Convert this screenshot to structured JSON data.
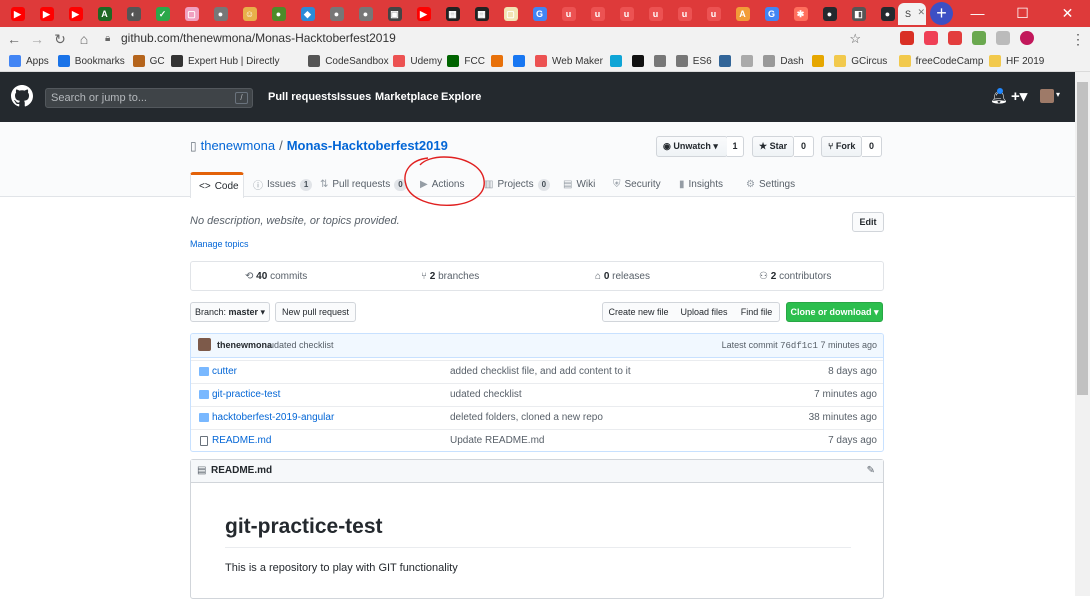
{
  "browser": {
    "url": "github.com/thenewmona/Monas-Hacktoberfest2019",
    "active_tab_label": "S",
    "tabs": [
      {
        "icon": "youtube-icon",
        "color": "#ff0000",
        "glyph": "▶"
      },
      {
        "icon": "youtube-icon",
        "color": "#ff0000",
        "glyph": "▶"
      },
      {
        "icon": "youtube-icon",
        "color": "#ff0000",
        "glyph": "▶"
      },
      {
        "icon": "code-icon",
        "color": "#1e6823",
        "glyph": "A"
      },
      {
        "icon": "git-icon",
        "color": "#555555",
        "glyph": "◐"
      },
      {
        "icon": "check-icon",
        "color": "#2ba84a",
        "glyph": "✓"
      },
      {
        "icon": "doc-icon",
        "color": "#f0a0c0",
        "glyph": "▢"
      },
      {
        "icon": "globe-icon",
        "color": "#777777",
        "glyph": "●"
      },
      {
        "icon": "smiley-icon",
        "color": "#e8b04a",
        "glyph": "☺"
      },
      {
        "icon": "leaf-icon",
        "color": "#4d8c2a",
        "glyph": "●"
      },
      {
        "icon": "shield-icon",
        "color": "#2b8ad8",
        "glyph": "◆"
      },
      {
        "icon": "globe-icon",
        "color": "#777777",
        "glyph": "●"
      },
      {
        "icon": "globe-icon",
        "color": "#777777",
        "glyph": "●"
      },
      {
        "icon": "terminal-icon",
        "color": "#444444",
        "glyph": "▣"
      },
      {
        "icon": "youtube-icon",
        "color": "#ff0000",
        "glyph": "▶"
      },
      {
        "icon": "qr-icon",
        "color": "#222222",
        "glyph": "▦"
      },
      {
        "icon": "qr-icon",
        "color": "#222222",
        "glyph": "▦"
      },
      {
        "icon": "doc-icon",
        "color": "#f2e3b3",
        "glyph": "▢"
      },
      {
        "icon": "google-icon",
        "color": "#4285f4",
        "glyph": "G"
      },
      {
        "icon": "udemy-icon",
        "color": "#ec5252",
        "glyph": "u"
      },
      {
        "icon": "udemy-icon",
        "color": "#ec5252",
        "glyph": "u"
      },
      {
        "icon": "udemy-icon",
        "color": "#ec5252",
        "glyph": "u"
      },
      {
        "icon": "udemy-icon",
        "color": "#ec5252",
        "glyph": "u"
      },
      {
        "icon": "udemy-icon",
        "color": "#ec5252",
        "glyph": "u"
      },
      {
        "icon": "udemy-icon",
        "color": "#ec5252",
        "glyph": "u"
      },
      {
        "icon": "warning-icon",
        "color": "#f29c38",
        "glyph": "A"
      },
      {
        "icon": "google-icon",
        "color": "#4285f4",
        "glyph": "G"
      },
      {
        "icon": "star-icon",
        "color": "#ff6f5e",
        "glyph": "✱"
      },
      {
        "icon": "github-icon",
        "color": "#24292e",
        "glyph": "●"
      },
      {
        "icon": "code-icon",
        "color": "#555555",
        "glyph": "◧"
      },
      {
        "icon": "github-icon",
        "color": "#24292e",
        "glyph": "●"
      }
    ],
    "extensions": [
      {
        "icon": "star-icon",
        "color": "#f2f2f2"
      },
      {
        "icon": "gmail-icon",
        "color": "#d93025"
      },
      {
        "icon": "pocket-icon",
        "color": "#ef4056"
      },
      {
        "icon": "adblock-icon",
        "color": "#e33d3d"
      },
      {
        "icon": "reader-icon",
        "color": "#6aa84f"
      },
      {
        "icon": "window-icon",
        "color": "#bbbbbb"
      },
      {
        "icon": "profile-avatar",
        "color": "#c2185b"
      }
    ],
    "bookmarks": [
      {
        "label": "Apps",
        "icon": "apps-icon",
        "color": "#4285f4"
      },
      {
        "label": "Bookmarks",
        "icon": "star-icon",
        "color": "#1a73e8"
      },
      {
        "label": "GC",
        "icon": "gc-icon",
        "color": "#b5651d"
      },
      {
        "label": "Expert Hub | Directly",
        "icon": "directly-icon",
        "color": "#333333"
      },
      {
        "label": "CodeSandbox",
        "icon": "codesandbox-icon",
        "color": "#555555"
      },
      {
        "label": "Udemy",
        "icon": "udemy-icon",
        "color": "#ec5252"
      },
      {
        "label": "FCC",
        "icon": "fcc-icon",
        "color": "#006400"
      },
      {
        "label": "",
        "icon": "circle-icon",
        "color": "#e8710a"
      },
      {
        "label": "",
        "icon": "facebook-icon",
        "color": "#1877f2"
      },
      {
        "label": "Web Maker",
        "icon": "webmaker-icon",
        "color": "#ec5252"
      },
      {
        "label": "",
        "icon": "u-icon",
        "color": "#0fa5d6"
      },
      {
        "label": "",
        "icon": "w-icon",
        "color": "#111111"
      },
      {
        "label": "",
        "icon": "gear-icon",
        "color": "#777777"
      },
      {
        "label": "ES6",
        "icon": "es6-icon",
        "color": "#777777"
      },
      {
        "label": "",
        "icon": "code-icon",
        "color": "#336699"
      },
      {
        "label": "",
        "icon": "dot-icon",
        "color": "#aaaaaa"
      },
      {
        "label": "Dash",
        "icon": "dash-icon",
        "color": "#999999"
      },
      {
        "label": "",
        "icon": "folder-icon",
        "color": "#e6a700"
      },
      {
        "label": "GCircus",
        "icon": "folder-icon",
        "color": "#f2c94c"
      },
      {
        "label": "freeCodeCamp",
        "icon": "folder-icon",
        "color": "#f2c94c"
      },
      {
        "label": "HF 2019",
        "icon": "folder-icon",
        "color": "#f2c94c"
      }
    ]
  },
  "github": {
    "search_placeholder": "Search or jump to...",
    "search_slash": "/",
    "nav": [
      "Pull requests",
      "Issues",
      "Marketplace",
      "Explore"
    ],
    "owner": "thenewmona",
    "separator": "/",
    "repo": "Monas-Hacktoberfest2019",
    "watch_label": "Unwatch",
    "watch_count": "1",
    "star_label": "Star",
    "star_count": "0",
    "fork_label": "Fork",
    "fork_count": "0",
    "tabs": [
      {
        "label": "Code",
        "count": "",
        "icon": "<>"
      },
      {
        "label": "Issues",
        "count": "1",
        "icon": "ⓘ"
      },
      {
        "label": "Pull requests",
        "count": "0",
        "icon": "⇅"
      },
      {
        "label": "Actions",
        "count": "",
        "icon": "▶"
      },
      {
        "label": "Projects",
        "count": "0",
        "icon": "▥"
      },
      {
        "label": "Wiki",
        "count": "",
        "icon": "▤"
      },
      {
        "label": "Security",
        "count": "",
        "icon": "⛨"
      },
      {
        "label": "Insights",
        "count": "",
        "icon": "▮"
      },
      {
        "label": "Settings",
        "count": "",
        "icon": "⚙"
      }
    ],
    "description": "No description, website, or topics provided.",
    "manage_topics": "Manage topics",
    "edit_label": "Edit",
    "summary": {
      "commits_count": "40",
      "commits_label": " commits",
      "branches_count": "2",
      "branches_label": " branches",
      "releases_count": "0",
      "releases_label": " releases",
      "contributors_count": "2",
      "contributors_label": " contributors"
    },
    "branch_label": "Branch: ",
    "branch_name": "master",
    "new_pr_label": "New pull request",
    "create_file_label": "Create new file",
    "upload_label": "Upload files",
    "find_label": "Find file",
    "clone_label": "Clone or download",
    "commit": {
      "author": "thenewmona",
      "message": "udated checklist",
      "latest_label": "Latest commit",
      "sha": "76df1c1",
      "age": "7 minutes ago"
    },
    "files": [
      {
        "name": "cutter",
        "message": "added checklist file, and add content to it",
        "age": "8 days ago",
        "type": "folder"
      },
      {
        "name": "git-practice-test",
        "message": "udated checklist",
        "age": "7 minutes ago",
        "type": "folder"
      },
      {
        "name": "hacktoberfest-2019-angular",
        "message": "deleted folders, cloned a new repo",
        "age": "38 minutes ago",
        "type": "folder"
      },
      {
        "name": "README.md",
        "message": "Update README.md",
        "age": "7 days ago",
        "type": "file"
      }
    ],
    "readme_title": "README.md",
    "readme_h1": "git-practice-test",
    "readme_text": "This is a repository to play with GIT functionality"
  },
  "colors": {
    "tabbar": "#de3a3a",
    "github_dark": "#24292e",
    "link": "#0366d6",
    "clone_green": "#2cbe4e",
    "annotation": "#e02020"
  }
}
